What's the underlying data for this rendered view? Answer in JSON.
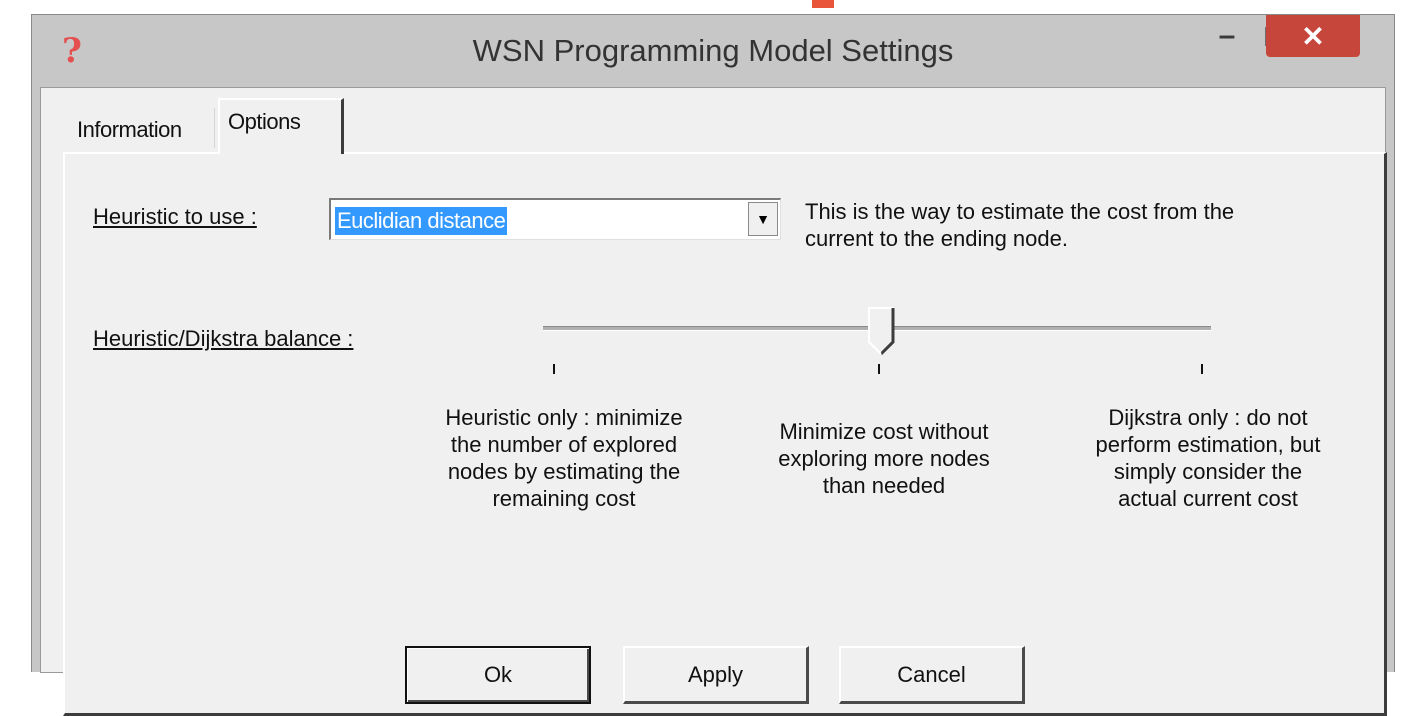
{
  "window": {
    "title": "WSN Programming Model Settings",
    "app_icon": "?",
    "minimize_glyph": "–",
    "close_glyph": "✕"
  },
  "tabs": [
    {
      "label": "Information",
      "selected": false
    },
    {
      "label": "Options",
      "selected": true
    }
  ],
  "heuristic": {
    "label": "Heuristic to use :",
    "selected": "Euclidian distance",
    "description_line1": "This is the way to estimate the cost from the",
    "description_line2": "current to the ending node."
  },
  "balance": {
    "label": "Heuristic/Dijkstra balance :",
    "value": 0.5,
    "left_caption": [
      "Heuristic only : minimize",
      "the number of explored",
      "nodes by estimating the",
      "remaining cost"
    ],
    "middle_caption": [
      "Minimize cost without",
      "exploring more nodes",
      "than needed"
    ],
    "right_caption": [
      "Dijkstra only : do not",
      "perform estimation, but",
      "simply consider the",
      "actual current cost"
    ]
  },
  "buttons": {
    "ok": "Ok",
    "apply": "Apply",
    "cancel": "Cancel"
  },
  "colors": {
    "selection": "#3399ff",
    "close_button": "#c7463b",
    "icon": "#e45050"
  }
}
